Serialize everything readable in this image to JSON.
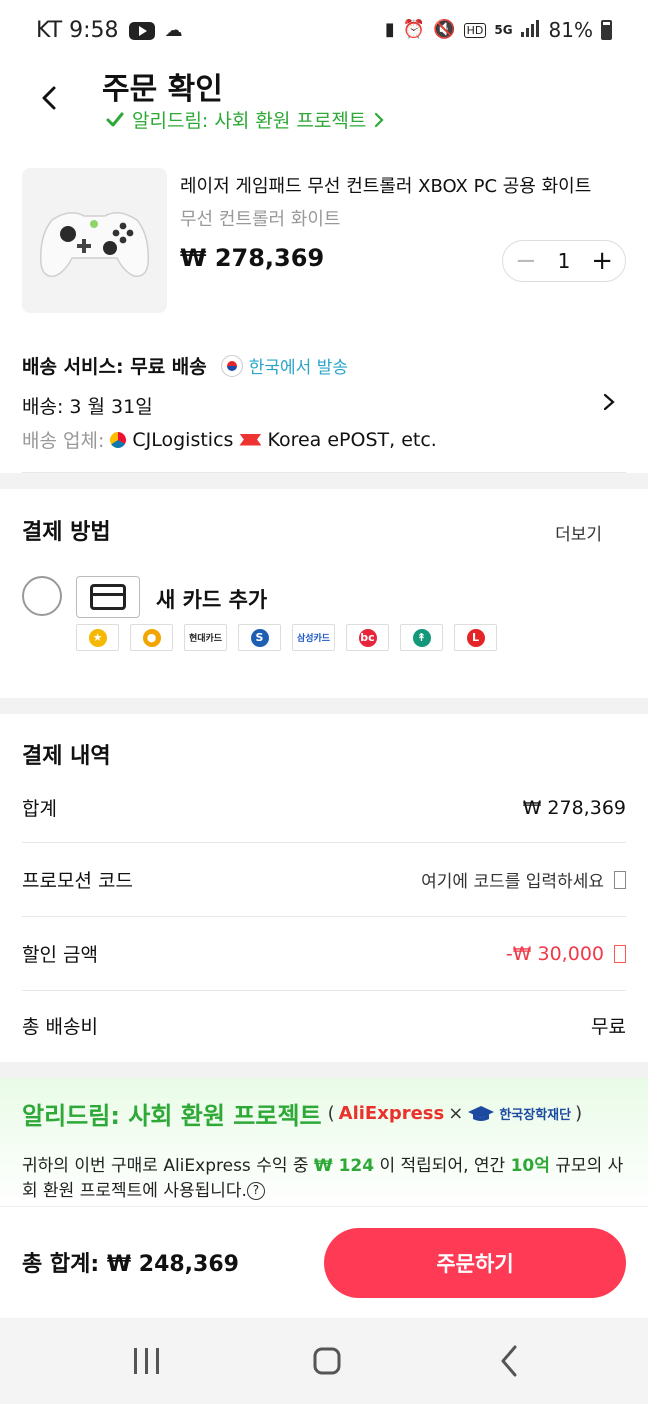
{
  "status_bar": {
    "carrier_time": "KT 9:58",
    "battery": "81%",
    "icons": [
      "youtube-icon",
      "cloud-icon",
      "battery-saver-icon",
      "alarm-icon",
      "mute-icon",
      "hd-icon",
      "5g-icon",
      "signal-icon",
      "battery-icon"
    ]
  },
  "header": {
    "title": "주문 확인",
    "project_link": "알리드림: 사회 환원 프로젝트"
  },
  "product": {
    "title": "레이저 게임패드 무선 컨트롤러 XBOX PC 공용 화이트",
    "variant": "무선 컨트롤러 화이트",
    "price": "₩ 278,369",
    "quantity": "1"
  },
  "shipping": {
    "service_label": "배송 서비스: 무료 배송",
    "origin": "한국에서 발송",
    "date": "배송: 3 월 31일",
    "carrier_label": "배송 업체:",
    "carrier_cj": "CJLogistics",
    "carrier_epost": "Korea ePOST, etc."
  },
  "payment_method": {
    "title": "결제 방법",
    "more": "더보기",
    "new_card": "새 카드 추가",
    "banks": [
      {
        "name": "kb-card",
        "color": "#f6b800",
        "text": "★"
      },
      {
        "name": "nh-card",
        "color": "#f0a500",
        "text": "●"
      },
      {
        "name": "hyundai-card",
        "color": "#222222",
        "text": "현대카드"
      },
      {
        "name": "shinhan-card",
        "color": "#1e5fb4",
        "text": "S"
      },
      {
        "name": "samsung-card",
        "color": "#1a57c8",
        "text": "삼성카드"
      },
      {
        "name": "bc-card",
        "color": "#e8263b",
        "text": "bc"
      },
      {
        "name": "hana-card",
        "color": "#14987a",
        "text": "↟"
      },
      {
        "name": "lotte-card",
        "color": "#e42426",
        "text": "L"
      }
    ]
  },
  "payment_details": {
    "title": "결제 내역",
    "subtotal_label": "합계",
    "subtotal_value": "₩ 278,369",
    "promo_label": "프로모션 코드",
    "promo_placeholder": "여기에 코드를 입력하세요",
    "discount_label": "할인 금액",
    "discount_value": "-₩ 30,000",
    "shipping_label": "총 배송비",
    "shipping_value": "무료"
  },
  "dream": {
    "title": "알리드림: 사회 환원 프로젝트",
    "partner1": "AliExpress",
    "times": "×",
    "partner2": "한국장학재단",
    "text_a": "귀하의 이번 구매로 AliExpress 수익 중 ",
    "amount": "₩ 124",
    "text_b": " 이 적립되어, 연간 ",
    "annual": "10억",
    "text_c": " 규모의 사회 환원 프로젝트에 사용됩니다."
  },
  "footer": {
    "total": "총 합계: ₩ 248,369",
    "order_button": "주문하기"
  },
  "colors": {
    "accent_green": "#2ea836",
    "primary_red": "#fe3a54",
    "discount_red": "#f03a4a",
    "origin_blue": "#2aa5c8"
  }
}
